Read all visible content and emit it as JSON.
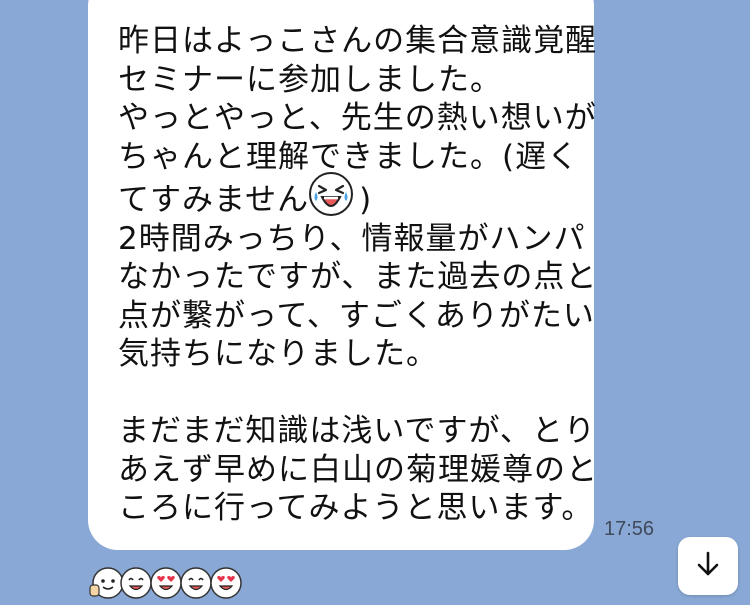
{
  "message": {
    "lines": [
      "昨日はよっこさんの集合意識覚醒",
      "セミナーに参加しました。",
      "やっとやっと、先生の熱い想いが",
      "ちゃんと理解できました。(遅く",
      "てすみません",
      "2時間みっちり、情報量がハンパ",
      "なかったですが、また過去の点と",
      "点が繋がって、すごくありがたい",
      "気持ちになりました。",
      "まだまだ知識は浅いですが、とり",
      "あえず早めに白山の菊理媛尊のと",
      "ころに行ってみようと思います。"
    ],
    "paren_close": ")",
    "emoji_icon": "crying-laughing-face-icon",
    "time": "17:56"
  },
  "reactions": [
    "thumbs-up-face-icon",
    "smiling-face-icon",
    "heart-eyes-face-icon",
    "smiling-face-icon",
    "heart-eyes-face-icon"
  ],
  "scroll_button_icon": "arrow-down-icon",
  "colors": {
    "background": "#8aa8d6",
    "bubble": "#ffffff",
    "text": "#111111",
    "time": "#3f4a5b"
  }
}
